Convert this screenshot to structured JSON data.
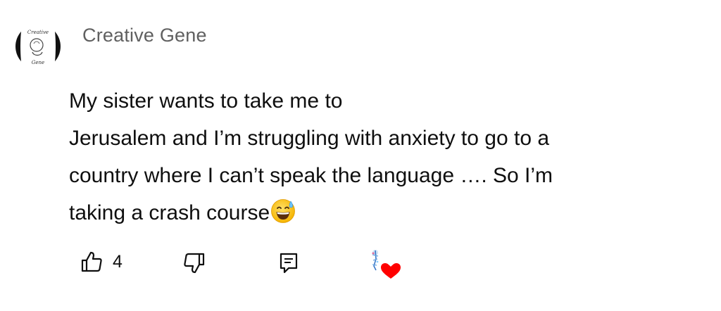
{
  "comment": {
    "author": "Creative Gene",
    "avatar_alt": "Creative Gene avatar",
    "text_lines": [
      "My sister wants to take me to",
      "Jerusalem and I’m struggling with anxiety to go to a",
      "country where I can’t speak the language …. So I’m",
      "taking a crash course"
    ],
    "emoji": "grinning-face-with-sweat"
  },
  "actions": {
    "like_icon": "thumbs-up-icon",
    "like_count": "4",
    "dislike_icon": "thumbs-down-icon",
    "reply_icon": "comment-reply-icon",
    "creator_heart_icon": "creator-heart-icon"
  },
  "colors": {
    "author": "#606060",
    "text": "#0f0f0f",
    "heart": "#ff0000",
    "background": "#ffffff"
  }
}
